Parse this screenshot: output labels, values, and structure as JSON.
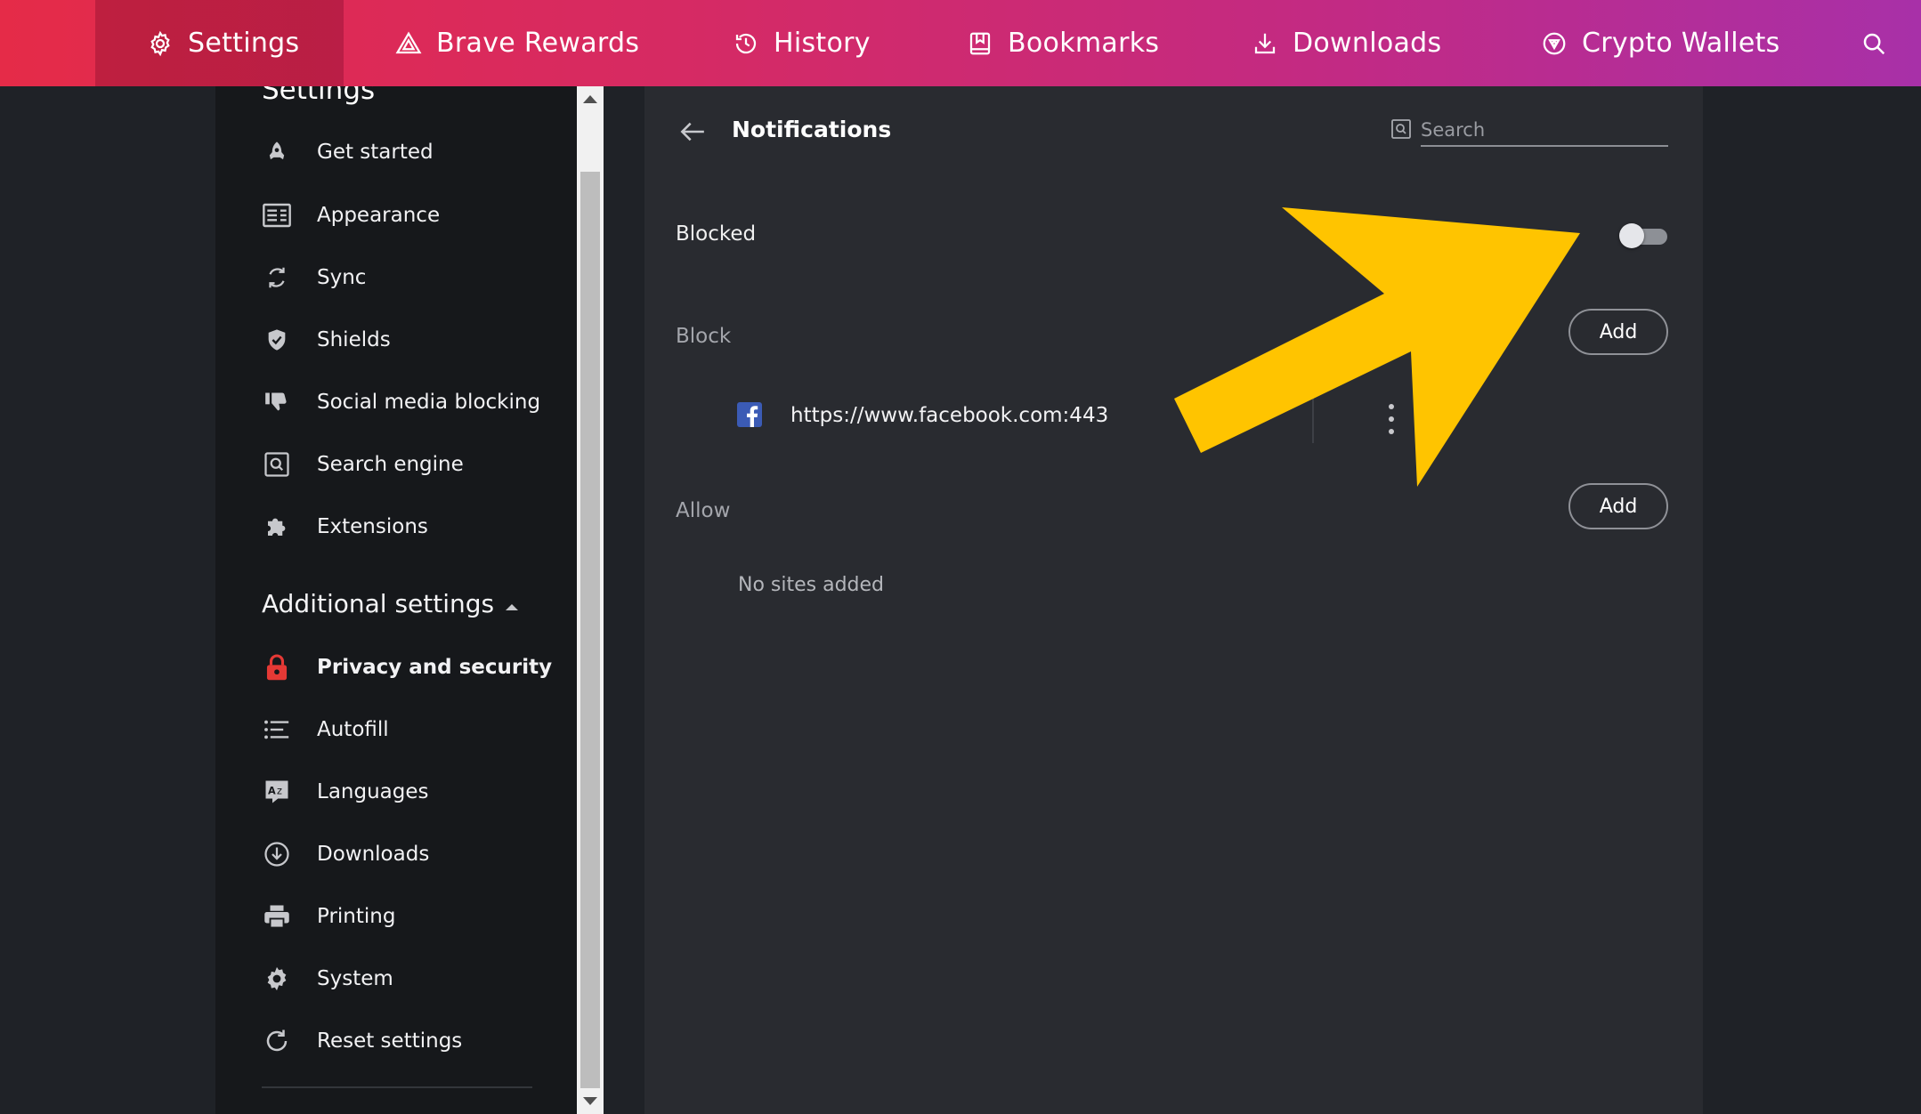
{
  "topnav": {
    "items": [
      {
        "label": "Settings",
        "icon": "gear-icon"
      },
      {
        "label": "Brave Rewards",
        "icon": "rewards-triangle-icon"
      },
      {
        "label": "History",
        "icon": "history-icon"
      },
      {
        "label": "Bookmarks",
        "icon": "bookmark-icon"
      },
      {
        "label": "Downloads",
        "icon": "download-icon"
      },
      {
        "label": "Crypto Wallets",
        "icon": "wallet-icon"
      }
    ],
    "search_icon": "search-icon"
  },
  "sidebar": {
    "heading": "Settings",
    "items": [
      {
        "label": "Get started",
        "icon": "rocket-icon"
      },
      {
        "label": "Appearance",
        "icon": "appearance-icon"
      },
      {
        "label": "Sync",
        "icon": "sync-icon"
      },
      {
        "label": "Shields",
        "icon": "shield-icon"
      },
      {
        "label": "Social media blocking",
        "icon": "thumbs-down-icon"
      },
      {
        "label": "Search engine",
        "icon": "search-engine-icon"
      },
      {
        "label": "Extensions",
        "icon": "puzzle-icon"
      }
    ],
    "additional_heading": "Additional settings",
    "additional_items": [
      {
        "label": "Privacy and security",
        "icon": "lock-icon"
      },
      {
        "label": "Autofill",
        "icon": "list-icon"
      },
      {
        "label": "Languages",
        "icon": "languages-icon"
      },
      {
        "label": "Downloads",
        "icon": "download-circle-icon"
      },
      {
        "label": "Printing",
        "icon": "printer-icon"
      },
      {
        "label": "System",
        "icon": "system-gear-icon"
      },
      {
        "label": "Reset settings",
        "icon": "reset-icon"
      }
    ]
  },
  "content": {
    "title": "Notifications",
    "search_placeholder": "Search",
    "blocked_label": "Blocked",
    "blocked_toggle_on": false,
    "block_section": "Block",
    "allow_section": "Allow",
    "add_label": "Add",
    "blocked_sites": [
      {
        "url": "https://www.facebook.com:443",
        "icon": "facebook-icon"
      }
    ],
    "allow_empty": "No sites added"
  },
  "colors": {
    "accent_start": "#e52b48",
    "accent_end": "#a830a8",
    "highlight_arrow": "#ffc400",
    "privacy_icon": "#e53935"
  }
}
